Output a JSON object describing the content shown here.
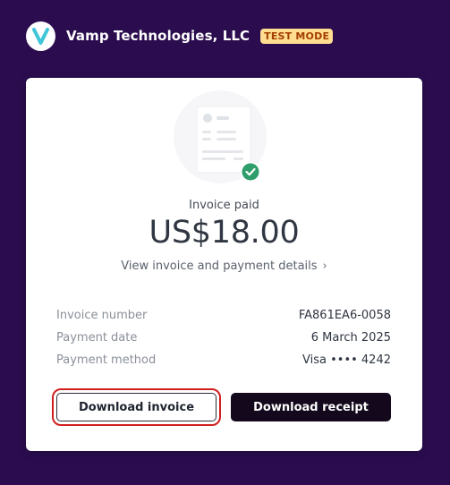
{
  "header": {
    "logo_icon": "vamp-logo-icon",
    "brand_name": "Vamp Technologies, LLC",
    "mode_badge": "TEST MODE"
  },
  "card": {
    "illustration_icon": "invoice-document-check-icon",
    "status_label": "Invoice paid",
    "amount": "US$18.00",
    "details_link": "View invoice and payment details",
    "details_link_icon": "chevron-right-icon",
    "info": [
      {
        "label": "Invoice number",
        "value": "FA861EA6-0058"
      },
      {
        "label": "Payment date",
        "value": "6 March 2025"
      },
      {
        "label": "Payment method",
        "value": "Visa •••• 4242"
      }
    ],
    "buttons": {
      "download_invoice": "Download invoice",
      "download_receipt": "Download receipt"
    }
  },
  "colors": {
    "background": "#2b0d4f",
    "badge_bg": "#ffde92",
    "badge_text": "#a43d00",
    "check_green": "#2f9e6a",
    "primary_button": "#13081c",
    "highlight_outline": "#d11f1f"
  }
}
